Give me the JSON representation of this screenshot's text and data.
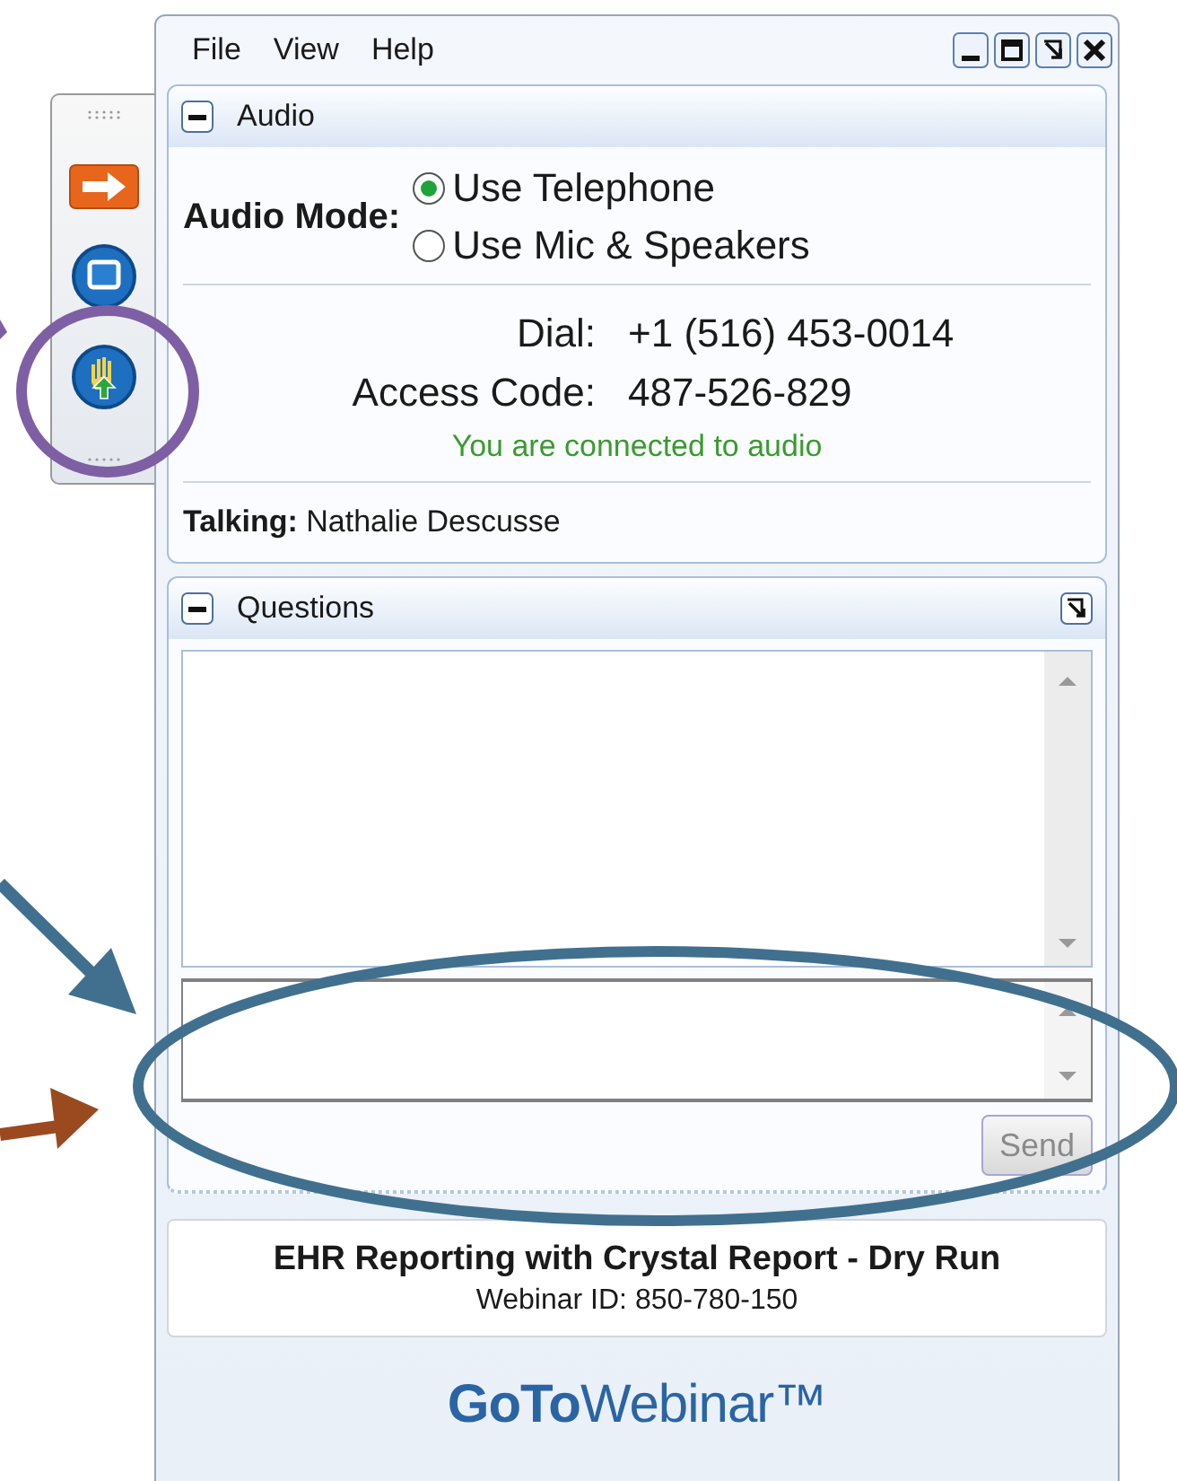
{
  "menu": [
    "File",
    "View",
    "Help"
  ],
  "audio": {
    "title": "Audio",
    "mode_label": "Audio Mode:",
    "modes": [
      {
        "label": "Use Telephone",
        "selected": true
      },
      {
        "label": "Use Mic & Speakers",
        "selected": false
      }
    ],
    "dial_label": "Dial:",
    "dial": "+1 (516) 453-0014",
    "access_label": "Access Code:",
    "access_code": "487-526-829",
    "status": "You are connected to audio",
    "talking": "**Talking:** Nathalie Descusse"
  },
  "questions": {
    "title": "Questions",
    "send": {
      "label": "Send",
      "disabled": true
    }
  },
  "webinar": {
    "title": "EHR Reporting with Crystal Report - Dry Run",
    "id_line": "Webinar ID: 850-780-150"
  },
  "logo": "**GoTo**Webinar™"
}
